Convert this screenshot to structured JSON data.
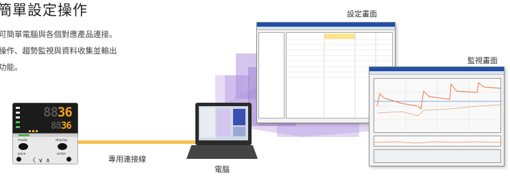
{
  "header": {
    "title": "簡單設定操作",
    "description_lines": [
      "可簡單電腦與各個對應產品連接。",
      "操作、趨勢監視與資料收集並輸出",
      "功能。"
    ]
  },
  "labels": {
    "settings_screen": "設定畫面",
    "monitor_screen": "監視畫面",
    "cable": "專用連接線",
    "computer": "電腦"
  },
  "device": {
    "pv_digits_dim": "88",
    "pv_digits_lit": "36",
    "sv_digits_dim": "88",
    "sv_digits_lit": "36",
    "button_mode": "mode",
    "button_display": "display",
    "button_para": "para",
    "button_enter": "enter",
    "arrows": "〈∨∧"
  },
  "colors": {
    "accent_orange": "#f4a21a",
    "cable_yellow": "#f7c24f",
    "purple": "#9b7fd0",
    "chart_trace": "#f08a5d",
    "chart_guide": "#7fa7d9"
  }
}
